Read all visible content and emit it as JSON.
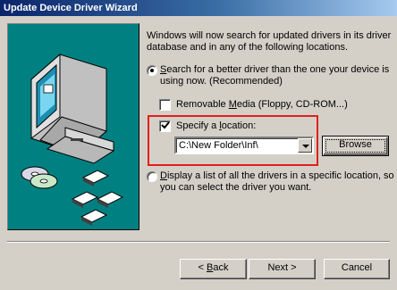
{
  "window": {
    "title": "Update Device Driver Wizard"
  },
  "intro_text": "Windows will now search for updated drivers in its driver database and in any of the following locations.",
  "options": {
    "search": {
      "label_ul": "S",
      "label_rest": "earch for a better driver than the one your device is using now. (Recommended)",
      "selected": true
    },
    "removable": {
      "label_pre": "Removable ",
      "label_ul": "M",
      "label_rest": "edia (Floppy, CD-ROM...)",
      "checked": false
    },
    "specify": {
      "label_pre": "Specify a ",
      "label_ul": "l",
      "label_rest": "ocation:",
      "checked": true
    },
    "location_value": "C:\\New Folder\\Inf\\",
    "browse_label": "Browse",
    "display_list": {
      "label_ul": "D",
      "label_rest": "isplay a list of all the drivers in a specific location, so you can select the driver you want.",
      "selected": false
    }
  },
  "buttons": {
    "back_pre": "< ",
    "back_ul": "B",
    "back_rest": "ack",
    "next": "Next >",
    "cancel": "Cancel"
  },
  "icons": [
    "computer-icon",
    "cd-disc-icon",
    "floppy-disk-icon"
  ],
  "colors": {
    "title_start": "#0a246a",
    "title_end": "#a6caf0",
    "art_background": "#008080",
    "highlight": "#e0201c",
    "face": "#d4d0c8"
  }
}
